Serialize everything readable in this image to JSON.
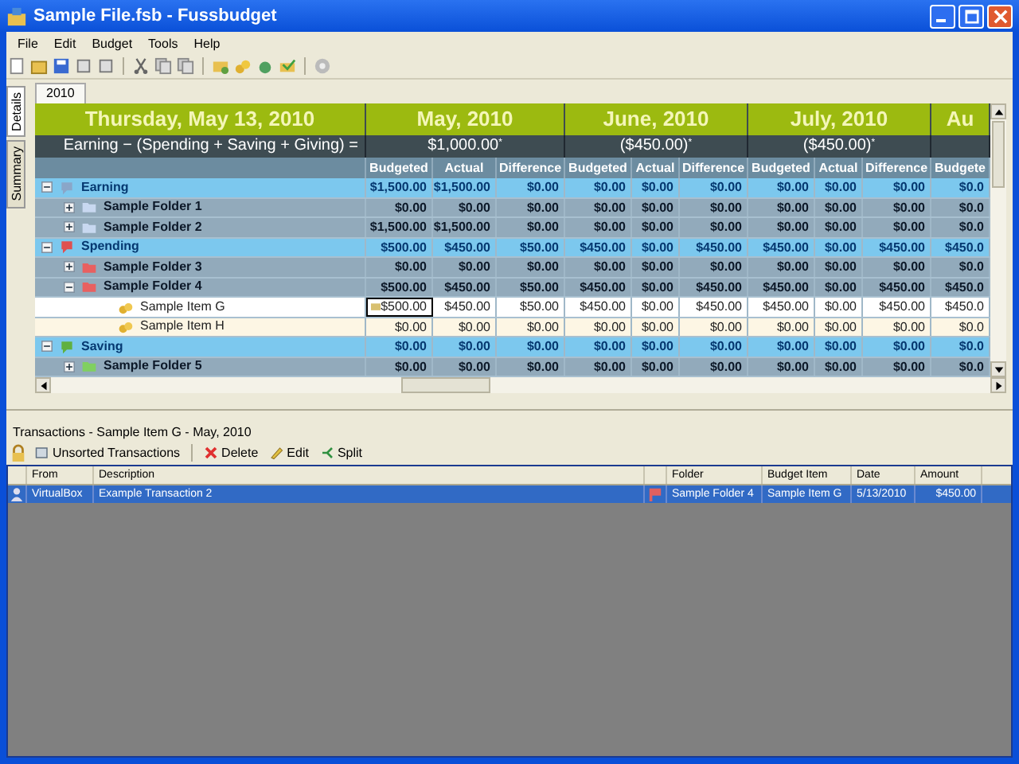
{
  "window": {
    "title": "Sample File.fsb - Fussbudget"
  },
  "menu": [
    "File",
    "Edit",
    "Budget",
    "Tools",
    "Help"
  ],
  "side_tabs": [
    {
      "label": "Details",
      "selected": true
    },
    {
      "label": "Summary",
      "selected": false
    }
  ],
  "year_tabs": [
    {
      "label": "2010",
      "selected": true
    }
  ],
  "grid": {
    "date_title": "Thursday, May 13, 2010",
    "formula": "Earning − (Spending + Saving + Giving) =",
    "months": [
      {
        "title": "May, 2010",
        "total": "$1,000.00$^{*}$",
        "columns": [
          "Budgeted",
          "Actual",
          "Difference"
        ]
      },
      {
        "title": "June, 2010",
        "total": "($450.00)$^{*}$",
        "columns": [
          "Budgeted",
          "Actual",
          "Difference"
        ]
      },
      {
        "title": "July, 2010",
        "total": "($450.00)$^{*}$",
        "columns": [
          "Budgeted",
          "Actual",
          "Difference"
        ]
      },
      {
        "title": "Au",
        "columns": [
          "Budgete"
        ]
      }
    ],
    "rows": [
      {
        "kind": "category",
        "name": "Earning",
        "color": "#8aa6c8",
        "expanded": true,
        "cells": [
          [
            "$1,500.00",
            "$1,500.00",
            "$0.00"
          ],
          [
            "$0.00",
            "$0.00",
            "$0.00"
          ],
          [
            "$0.00",
            "$0.00",
            "$0.00"
          ],
          [
            "$0.0"
          ]
        ],
        "children": [
          {
            "kind": "folder",
            "name": "Sample Folder 1",
            "color": "#c8d8f0",
            "expanded": false,
            "cells": [
              [
                "$0.00",
                "$0.00",
                "$0.00"
              ],
              [
                "$0.00",
                "$0.00",
                "$0.00"
              ],
              [
                "$0.00",
                "$0.00",
                "$0.00"
              ],
              [
                "$0.0"
              ]
            ]
          },
          {
            "kind": "folder",
            "name": "Sample Folder 2",
            "color": "#c8d8f0",
            "expanded": false,
            "cells": [
              [
                "$1,500.00",
                "$1,500.00",
                "$0.00"
              ],
              [
                "$0.00",
                "$0.00",
                "$0.00"
              ],
              [
                "$0.00",
                "$0.00",
                "$0.00"
              ],
              [
                "$0.0"
              ]
            ]
          }
        ]
      },
      {
        "kind": "category",
        "name": "Spending",
        "color": "#e05050",
        "expanded": true,
        "cells": [
          [
            "$500.00",
            "$450.00",
            "$50.00"
          ],
          [
            "$450.00",
            "$0.00",
            "$450.00"
          ],
          [
            "$450.00",
            "$0.00",
            "$450.00"
          ],
          [
            "$450.0"
          ]
        ],
        "children": [
          {
            "kind": "folder",
            "name": "Sample Folder 3",
            "color": "#e86060",
            "expanded": false,
            "cells": [
              [
                "$0.00",
                "$0.00",
                "$0.00"
              ],
              [
                "$0.00",
                "$0.00",
                "$0.00"
              ],
              [
                "$0.00",
                "$0.00",
                "$0.00"
              ],
              [
                "$0.0"
              ]
            ]
          },
          {
            "kind": "folder",
            "name": "Sample Folder 4",
            "color": "#e86060",
            "expanded": true,
            "cells": [
              [
                "$500.00",
                "$450.00",
                "$50.00"
              ],
              [
                "$450.00",
                "$0.00",
                "$450.00"
              ],
              [
                "$450.00",
                "$0.00",
                "$450.00"
              ],
              [
                "$450.0"
              ]
            ],
            "children": [
              {
                "kind": "item",
                "name": "Sample Item G",
                "selected": true,
                "cells": [
                  [
                    "$500.00",
                    "$450.00",
                    "$50.00"
                  ],
                  [
                    "$450.00",
                    "$0.00",
                    "$450.00"
                  ],
                  [
                    "$450.00",
                    "$0.00",
                    "$450.00"
                  ],
                  [
                    "$450.0"
                  ]
                ]
              },
              {
                "kind": "item",
                "name": "Sample Item H",
                "selected": false,
                "cells": [
                  [
                    "$0.00",
                    "$0.00",
                    "$0.00"
                  ],
                  [
                    "$0.00",
                    "$0.00",
                    "$0.00"
                  ],
                  [
                    "$0.00",
                    "$0.00",
                    "$0.00"
                  ],
                  [
                    "$0.0"
                  ]
                ]
              }
            ]
          }
        ]
      },
      {
        "kind": "category",
        "name": "Saving",
        "color": "#60b040",
        "expanded": true,
        "cells": [
          [
            "$0.00",
            "$0.00",
            "$0.00"
          ],
          [
            "$0.00",
            "$0.00",
            "$0.00"
          ],
          [
            "$0.00",
            "$0.00",
            "$0.00"
          ],
          [
            "$0.0"
          ]
        ],
        "children": [
          {
            "kind": "folder",
            "name": "Sample Folder 5",
            "color": "#80d060",
            "expanded": false,
            "cells": [
              [
                "$0.00",
                "$0.00",
                "$0.00"
              ],
              [
                "$0.00",
                "$0.00",
                "$0.00"
              ],
              [
                "$0.00",
                "$0.00",
                "$0.00"
              ],
              [
                "$0.0"
              ]
            ]
          }
        ]
      }
    ]
  },
  "transactions": {
    "title": "Transactions - Sample Item G - May, 2010",
    "toolbar": [
      {
        "kind": "unsorted",
        "label": "Unsorted Transactions"
      },
      {
        "kind": "delete",
        "label": "Delete"
      },
      {
        "kind": "edit",
        "label": "Edit"
      },
      {
        "kind": "split",
        "label": "Split"
      }
    ],
    "columns": [
      "From",
      "Description",
      "Folder",
      "Budget Item",
      "Date",
      "Amount"
    ],
    "rows": [
      {
        "from": "VirtualBox",
        "description": "Example Transaction 2",
        "folder": "Sample Folder 4",
        "budget_item": "Sample Item G",
        "date": "5/13/2010",
        "amount": "$450.00",
        "selected": true
      }
    ]
  }
}
